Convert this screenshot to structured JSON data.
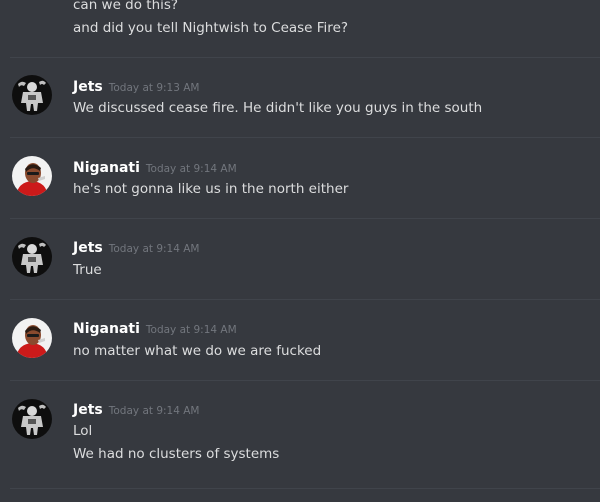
{
  "top_lines": [
    "can we do this?",
    "and did you tell Nightwish to Cease Fire?"
  ],
  "messages": [
    {
      "author": "Jets",
      "avatar_icon": "jets-avatar-icon",
      "timestamp": "Today at 9:13 AM",
      "lines": [
        "We discussed cease fire. He didn't like you guys in the south"
      ]
    },
    {
      "author": "Niganati",
      "avatar_icon": "niganati-avatar-icon",
      "timestamp": "Today at 9:14 AM",
      "lines": [
        "he's not gonna like us in the north either"
      ]
    },
    {
      "author": "Jets",
      "avatar_icon": "jets-avatar-icon",
      "timestamp": "Today at 9:14 AM",
      "lines": [
        "True"
      ]
    },
    {
      "author": "Niganati",
      "avatar_icon": "niganati-avatar-icon",
      "timestamp": "Today at 9:14 AM",
      "lines": [
        "no matter what we do we are fucked"
      ]
    },
    {
      "author": "Jets",
      "avatar_icon": "jets-avatar-icon",
      "timestamp": "Today at 9:14 AM",
      "lines": [
        "Lol",
        "We had no clusters of systems"
      ]
    }
  ],
  "colors": {
    "background": "#36393f",
    "divider": "#40444b",
    "username": "#ffffff",
    "message_text": "#dcddde",
    "timestamp": "#72767d"
  }
}
